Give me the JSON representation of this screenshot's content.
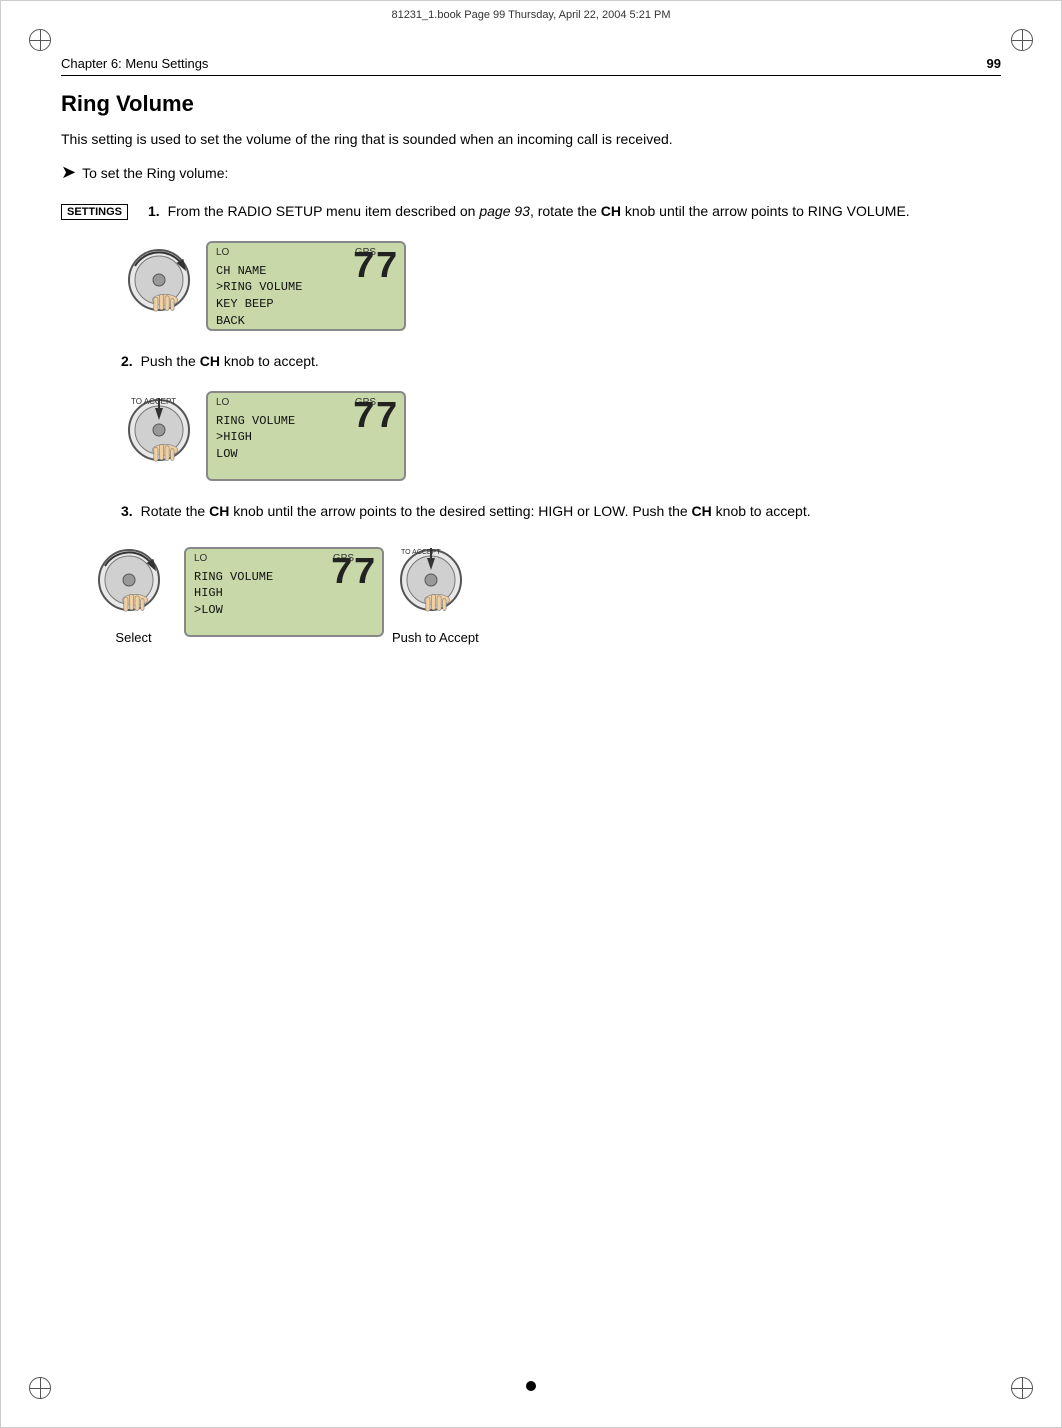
{
  "page": {
    "top_info": "81231_1.book  Page 99  Thursday, April 22, 2004  5:21 PM",
    "header_left": "Chapter 6: Menu Settings",
    "header_right": "99",
    "section_title": "Ring Volume",
    "intro_text": "This setting is used to set the volume of the ring that is sounded when an incoming call is received.",
    "arrow_text": "To set the Ring volume:",
    "settings_badge": "SETTINGS",
    "step1_text": "From the RADIO SETUP menu item described on ",
    "step1_italic": "page 93",
    "step1_text2": ", rotate the ",
    "step1_bold": "CH",
    "step1_text3": " knob until the arrow points to RING VOLUME.",
    "step2_text": "Push the ",
    "step2_bold": "CH",
    "step2_text2": " knob to accept.",
    "step3_text": "Rotate the ",
    "step3_bold1": "CH",
    "step3_text2": " knob until the arrow points to the desired setting: HIGH or LOW. Push the ",
    "step3_bold2": "CH",
    "step3_text3": " knob to accept.",
    "select_label": "Select",
    "push_to_accept_label": "Push to Accept",
    "lcd1": {
      "lo": "LO",
      "gps": "GPS",
      "line1": "CH NAME",
      "line2": ">RING VOLUME",
      "line3": "KEY BEEP",
      "line4": "BACK",
      "big_number": "77"
    },
    "lcd2": {
      "lo": "LO",
      "gps": "GPS",
      "line1": "RING VOLUME",
      "line2": ">HIGH",
      "line3": " LOW",
      "big_number": "77"
    },
    "lcd3": {
      "lo": "LO",
      "gps": "GPS",
      "line1": "RING VOLUME",
      "line2": " HIGH",
      "line3": ">LOW",
      "big_number": "77"
    }
  }
}
